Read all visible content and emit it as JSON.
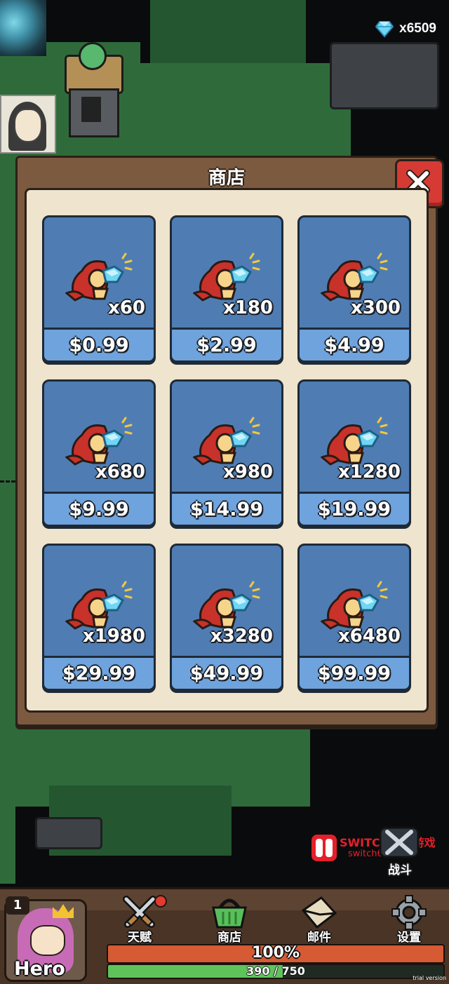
{
  "currency": {
    "icon": "diamond-icon",
    "amount": "x6509"
  },
  "shop": {
    "title": "商店",
    "close_icon": "close-icon",
    "items": [
      {
        "quantity": "x60",
        "price": "$0.99"
      },
      {
        "quantity": "x180",
        "price": "$2.99"
      },
      {
        "quantity": "x300",
        "price": "$4.99"
      },
      {
        "quantity": "x680",
        "price": "$9.99"
      },
      {
        "quantity": "x980",
        "price": "$14.99"
      },
      {
        "quantity": "x1280",
        "price": "$19.99"
      },
      {
        "quantity": "x1980",
        "price": "$29.99"
      },
      {
        "quantity": "x3280",
        "price": "$49.99"
      },
      {
        "quantity": "x6480",
        "price": "$99.99"
      }
    ]
  },
  "battle": {
    "label": "战斗"
  },
  "watermark": {
    "line1": "SWITCH618游戏",
    "line2": "switch618.com"
  },
  "hero": {
    "level": "1",
    "name": "Hero"
  },
  "nav": [
    {
      "label": "天赋",
      "icon": "crossed-swords-icon",
      "has_notification": true
    },
    {
      "label": "商店",
      "icon": "shopping-basket-icon"
    },
    {
      "label": "邮件",
      "icon": "envelope-icon"
    },
    {
      "label": "设置",
      "icon": "gear-icon"
    }
  ],
  "status": {
    "hp_text": "100%",
    "hp_fraction": 1.0,
    "xp_text": "390 / 750",
    "xp_fraction": 0.52
  },
  "footer": {
    "trial_text": "trial version"
  },
  "colors": {
    "card_blue": "#4f7db3",
    "price_band": "#6ea3dd",
    "modal_wood": "#7c5a40",
    "panel_cream": "#efe4cd",
    "close_red": "#d63a34",
    "hp_orange": "#d65a34",
    "xp_green": "#5ec45a"
  }
}
